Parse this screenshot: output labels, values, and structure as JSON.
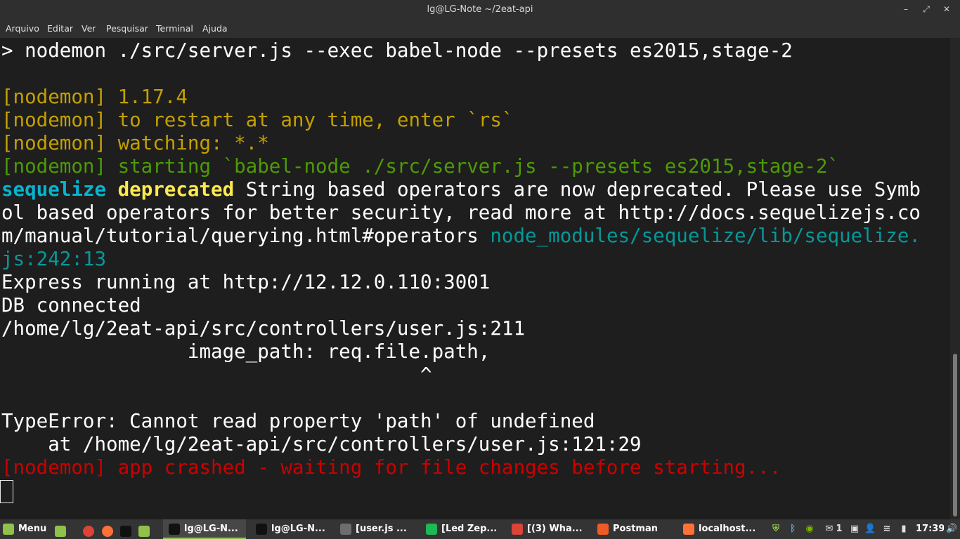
{
  "window": {
    "title": "lg@LG-Note ~/2eat-api",
    "minimize": "–",
    "maximize": "⤢",
    "close": "✕"
  },
  "menu": [
    "Arquivo",
    "Editar",
    "Ver",
    "Pesquisar",
    "Terminal",
    "Ajuda"
  ],
  "terminal": {
    "lines": [
      {
        "segments": [
          {
            "text": "> nodemon ./src/server.js --exec babel-node --presets es2015,stage-2",
            "cls": ""
          }
        ]
      },
      {
        "segments": []
      },
      {
        "segments": [
          {
            "text": "[nodemon] 1.17.4",
            "cls": "yellow"
          }
        ]
      },
      {
        "segments": [
          {
            "text": "[nodemon] to restart at any time, enter `rs`",
            "cls": "yellow"
          }
        ]
      },
      {
        "segments": [
          {
            "text": "[nodemon] watching: *.*",
            "cls": "yellow"
          }
        ]
      },
      {
        "segments": [
          {
            "text": "[nodemon] starting `babel-node ./src/server.js --presets es2015,stage-2`",
            "cls": "green"
          }
        ]
      },
      {
        "segments": [
          {
            "text": "sequelize",
            "cls": "cyan-b"
          },
          {
            "text": " ",
            "cls": ""
          },
          {
            "text": "deprecated",
            "cls": "yellow-b"
          },
          {
            "text": " String based operators are now deprecated. Please use Symb",
            "cls": ""
          }
        ]
      },
      {
        "segments": [
          {
            "text": "ol based operators for better security, read more at http://docs.sequelizejs.co",
            "cls": ""
          }
        ]
      },
      {
        "segments": [
          {
            "text": "m/manual/tutorial/querying.html#operators ",
            "cls": ""
          },
          {
            "text": "node_modules/sequelize/lib/sequelize.",
            "cls": "teal"
          }
        ]
      },
      {
        "segments": [
          {
            "text": "js:242:13",
            "cls": "teal"
          }
        ]
      },
      {
        "segments": [
          {
            "text": "Express running at http://12.12.0.110:3001",
            "cls": ""
          }
        ]
      },
      {
        "segments": [
          {
            "text": "DB connected",
            "cls": ""
          }
        ]
      },
      {
        "segments": [
          {
            "text": "/home/lg/2eat-api/src/controllers/user.js:211",
            "cls": ""
          }
        ]
      },
      {
        "segments": [
          {
            "text": "                image_path: req.file.path,",
            "cls": ""
          }
        ]
      },
      {
        "segments": [
          {
            "text": "                                    ^",
            "cls": ""
          }
        ]
      },
      {
        "segments": []
      },
      {
        "segments": [
          {
            "text": "TypeError: Cannot read property 'path' of undefined",
            "cls": ""
          }
        ]
      },
      {
        "segments": [
          {
            "text": "    at /home/lg/2eat-api/src/controllers/user.js:121:29",
            "cls": ""
          }
        ]
      },
      {
        "segments": [
          {
            "text": "[nodemon] app crashed - waiting for file changes before starting...",
            "cls": "red"
          }
        ]
      }
    ]
  },
  "panel": {
    "menu_label": "Menu",
    "tasks": [
      {
        "label": "lg@LG-N...",
        "icon_color": "#111111",
        "active": true
      },
      {
        "label": "lg@LG-N...",
        "icon_color": "#111111",
        "active": false
      },
      {
        "label": "[user.js ...",
        "icon_color": "#6d6d6d",
        "active": false
      },
      {
        "label": "[Led Zep...",
        "icon_color": "#1db954",
        "active": false
      },
      {
        "label": "[(3) Wha...",
        "icon_color": "#db4437",
        "active": false
      },
      {
        "label": "Postman",
        "icon_color": "#ef5b25",
        "active": false
      },
      {
        "label": "localhost...",
        "icon_color": "#ff7139",
        "active": false
      }
    ],
    "tray": {
      "badge_count": "1",
      "clock": "17:39"
    }
  },
  "colors": {
    "accent": "#8fc14b",
    "terminal_bg": "#1e1e1e"
  }
}
